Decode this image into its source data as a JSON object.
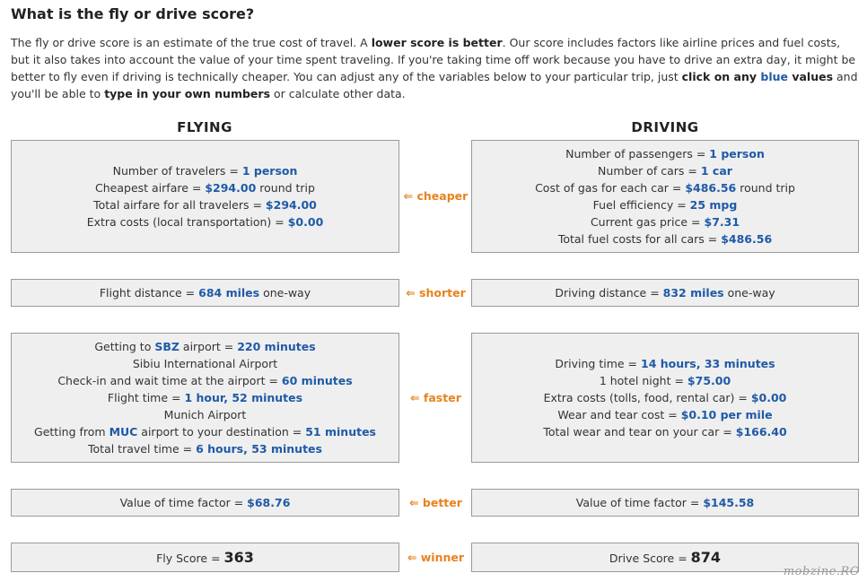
{
  "title": "What is the fly or drive score?",
  "intro": {
    "t1": "The fly or drive score is an estimate of the true cost of travel. A ",
    "b1": "lower score is better",
    "t2": ". Our score includes factors like airline prices and fuel costs, but it also takes into account the value of your time spent traveling. If you're taking time off work because you have to drive an extra day, it might be better to fly even if driving is technically cheaper. You can adjust any of the variables below to your particular trip, just ",
    "b2": "click on any ",
    "blue": "blue",
    "b3": " values",
    "t3": " and you'll be able to ",
    "b4": "type in your own numbers",
    "t4": " or calculate other data."
  },
  "headers": {
    "flying": "FLYING",
    "driving": "DRIVING"
  },
  "comparisons": {
    "cost": "⇐ cheaper",
    "distance": "⇐ shorter",
    "time": "⇐ faster",
    "value": "⇐ better",
    "score": "⇐ winner"
  },
  "flying": {
    "cost": {
      "travelers_label": "Number of travelers = ",
      "travelers_value": "1 person",
      "airfare_label": "Cheapest airfare = ",
      "airfare_value": "$294.00",
      "airfare_suffix": " round trip",
      "total_label": "Total airfare for all travelers = ",
      "total_value": "$294.00",
      "extra_label": "Extra costs (local transportation) = ",
      "extra_value": "$0.00"
    },
    "distance": {
      "label": "Flight distance = ",
      "value": "684 miles",
      "suffix": " one-way"
    },
    "time": {
      "getting_to_prefix": "Getting to ",
      "origin_code": "SBZ",
      "getting_to_mid": " airport = ",
      "getting_to_value": "220 minutes",
      "origin_airport": "Sibiu International Airport",
      "checkin_label": "Check-in and wait time at the airport = ",
      "checkin_value": "60 minutes",
      "flight_label": "Flight time = ",
      "flight_value": "1 hour, 52 minutes",
      "dest_airport": "Munich Airport",
      "getting_from_prefix": "Getting from ",
      "dest_code": "MUC",
      "getting_from_mid": " airport to your destination = ",
      "getting_from_value": "51 minutes",
      "total_label": "Total travel time = ",
      "total_value": "6 hours, 53 minutes"
    },
    "value": {
      "label": "Value of time factor = ",
      "value": "$68.76"
    },
    "score": {
      "label": "Fly Score = ",
      "value": "363"
    }
  },
  "driving": {
    "cost": {
      "passengers_label": "Number of passengers = ",
      "passengers_value": "1 person",
      "cars_label": "Number of cars = ",
      "cars_value": "1 car",
      "gas_label": "Cost of gas for each car = ",
      "gas_value": "$486.56",
      "gas_suffix": " round trip",
      "eff_label": "Fuel efficiency = ",
      "eff_value": "25 mpg",
      "price_label": "Current gas price = ",
      "price_value": "$7.31",
      "total_label": "Total fuel costs for all cars = ",
      "total_value": "$486.56"
    },
    "distance": {
      "label": "Driving distance = ",
      "value": "832 miles",
      "suffix": " one-way"
    },
    "time": {
      "drive_label": "Driving time = ",
      "drive_value": "14 hours, 33 minutes",
      "hotel_label": "1 hotel night = ",
      "hotel_value": "$75.00",
      "extra_label": "Extra costs (tolls, food, rental car) = ",
      "extra_value": "$0.00",
      "wear_label": "Wear and tear cost = ",
      "wear_value": "$0.10 per mile",
      "wear_total_label": "Total wear and tear on your car = ",
      "wear_total_value": "$166.40"
    },
    "value": {
      "label": "Value of time factor = ",
      "value": "$145.58"
    },
    "score": {
      "label": "Drive Score = ",
      "value": "874"
    }
  },
  "watermark": "mobzine.RO"
}
